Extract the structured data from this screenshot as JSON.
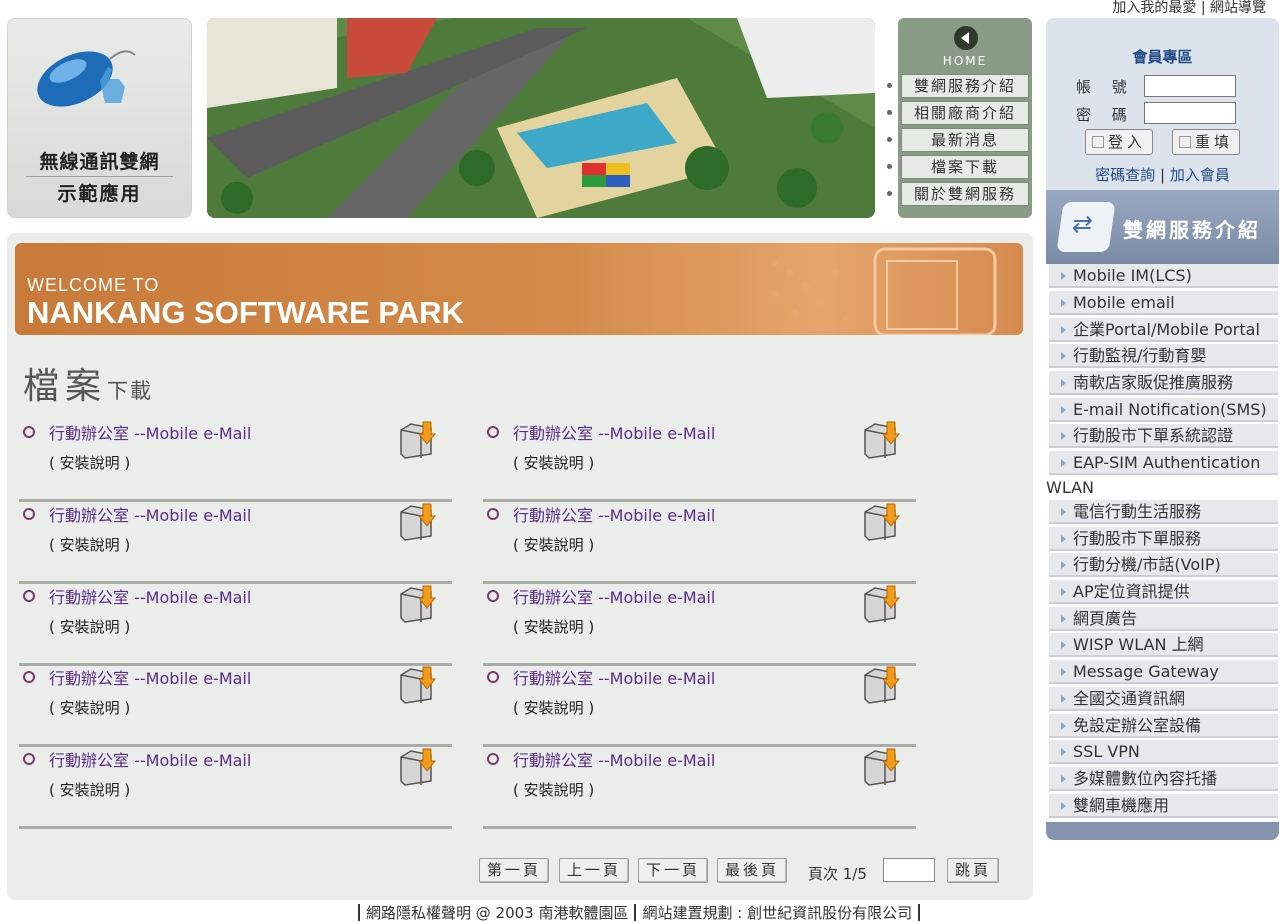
{
  "top_links": {
    "favorite": "加入我的最愛",
    "separator": "|",
    "sitemap": "網站導覽"
  },
  "logo": {
    "line1": "無線通訊雙網",
    "line2": "示範應用"
  },
  "nav": {
    "home": "HOME",
    "items": [
      "雙網服務介紹",
      "相關廠商介紹",
      "最新消息",
      "檔案下載",
      "關於雙網服務"
    ]
  },
  "welcome": {
    "line1": "WELCOME TO",
    "line2": "NANKANG SOFTWARE PARK"
  },
  "section": {
    "title_big": "檔案",
    "title_small": "下載"
  },
  "files": [
    {
      "name": "行動辦公室 --Mobile e-Mail",
      "desc": "( 安裝說明 )"
    },
    {
      "name": "行動辦公室 --Mobile e-Mail",
      "desc": "( 安裝說明 )"
    },
    {
      "name": "行動辦公室 --Mobile e-Mail",
      "desc": "( 安裝說明 )"
    },
    {
      "name": "行動辦公室 --Mobile e-Mail",
      "desc": "( 安裝說明 )"
    },
    {
      "name": "行動辦公室 --Mobile e-Mail",
      "desc": "( 安裝說明 )"
    },
    {
      "name": "行動辦公室 --Mobile e-Mail",
      "desc": "( 安裝說明 )"
    },
    {
      "name": "行動辦公室 --Mobile e-Mail",
      "desc": "( 安裝說明 )"
    },
    {
      "name": "行動辦公室 --Mobile e-Mail",
      "desc": "( 安裝說明 )"
    },
    {
      "name": "行動辦公室 --Mobile e-Mail",
      "desc": "( 安裝說明 )"
    },
    {
      "name": "行動辦公室 --Mobile e-Mail",
      "desc": "( 安裝說明 )"
    }
  ],
  "pagination": {
    "first": "第一頁",
    "prev": "上一頁",
    "next": "下一頁",
    "last": "最後頁",
    "page_info": "頁次 1/5",
    "go": "跳頁",
    "page_input": ""
  },
  "footer": {
    "privacy": "網路隱私權聲明 @ 2003 南港軟體園區",
    "builder": "網站建置規劃 : 創世紀資訊股份有限公司"
  },
  "member": {
    "title": "會員專區",
    "account_label": "帳 號 :",
    "password_label": "密 碼 :",
    "account_value": "",
    "password_value": "",
    "login": "登入",
    "reset": "重填",
    "forgot": "密碼查詢",
    "separator": "|",
    "join": "加入會員"
  },
  "services": {
    "title": "雙網服務介紹",
    "items": [
      "Mobile IM(LCS)",
      "Mobile email",
      "企業Portal/Mobile Portal",
      "行動監視/行動育嬰",
      "南軟店家販促推廣服務",
      "E-mail Notification(SMS)",
      "行動股市下單系統認證",
      "EAP-SIM Authentication",
      "電信行動生活服務",
      "行動股市下單服務",
      "行動分機/市話(VoIP)",
      "AP定位資訊提供",
      "網頁廣告",
      "WISP WLAN 上網",
      "Message Gateway",
      "全國交通資訊網",
      "免設定辦公室設備",
      "SSL VPN",
      "多媒體數位內容托播",
      "雙網車機應用"
    ],
    "wlan_overflow": "WLAN"
  },
  "colors": {
    "link_purple": "#5a2d8a",
    "member_blue": "#1f4a86",
    "welcome_orange": "#d48b4a",
    "nav_green": "#8a9b87"
  }
}
